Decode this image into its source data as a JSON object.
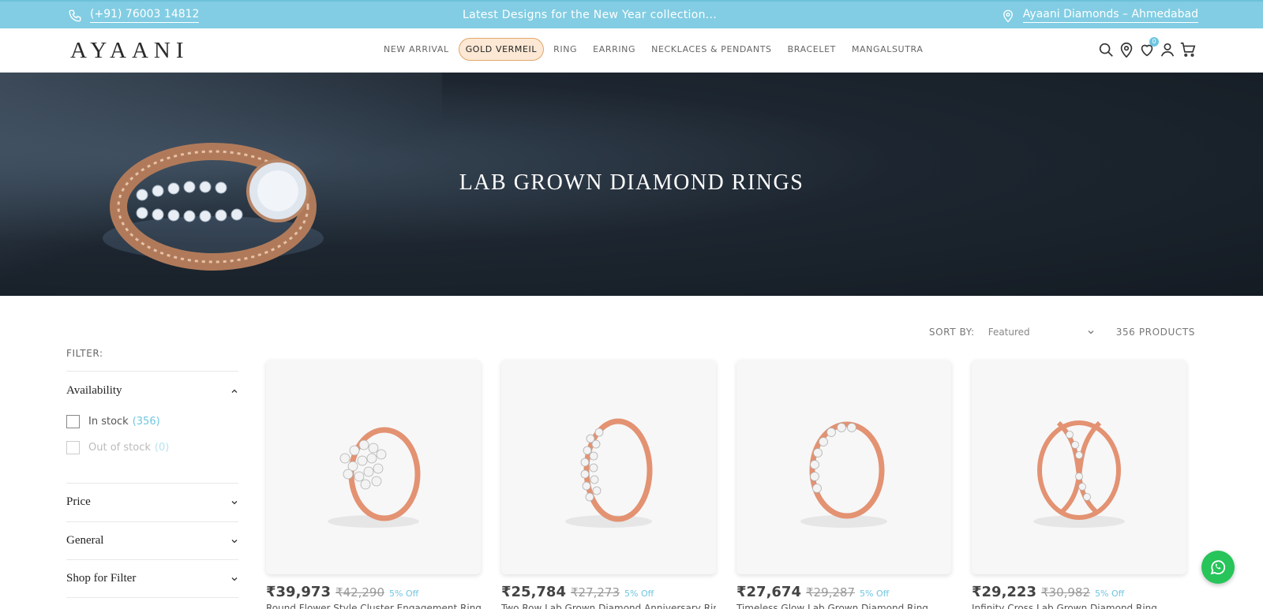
{
  "topbar": {
    "phone": "(+91) 76003 14812",
    "phone_icon": "phone-icon",
    "promo": "Latest Designs for the New Year collection...",
    "store": "Ayaani Diamonds – Ahmedabad",
    "store_icon": "location-pin-icon"
  },
  "header": {
    "logo": "AYAANI",
    "nav": [
      {
        "label": "NEW ARRIVAL"
      },
      {
        "label": "GOLD VERMEIL"
      },
      {
        "label": "RING"
      },
      {
        "label": "EARRING"
      },
      {
        "label": "NECKLACES & PENDANTS"
      },
      {
        "label": "BRACELET"
      },
      {
        "label": "MANGALSUTRA"
      }
    ],
    "wishlist_count": "0",
    "icons": [
      "search-icon",
      "store-locator-icon",
      "wishlist-heart-icon",
      "account-icon",
      "cart-icon"
    ]
  },
  "hero": {
    "title": "LAB GROWN DIAMOND RINGS"
  },
  "listing": {
    "sort_label": "SORT BY:",
    "sort_value": "Featured",
    "product_count": "356 PRODUCTS"
  },
  "filters": {
    "title": "FILTER:",
    "availability": {
      "label": "Availability",
      "options": [
        {
          "label": "In stock",
          "count": "(356)"
        },
        {
          "label": "Out of stock",
          "count": "(0)"
        }
      ]
    },
    "price": {
      "label": "Price"
    },
    "general": {
      "label": "General"
    },
    "shop_for": {
      "label": "Shop for Filter"
    }
  },
  "products": [
    {
      "price": "₹39,973",
      "mrp": "₹42,290",
      "off": "5% Off",
      "name": "Round Flower Style Cluster Engagement Ring"
    },
    {
      "price": "₹25,784",
      "mrp": "₹27,273",
      "off": "5% Off",
      "name": "Two Row Lab Grown Diamond Anniversary Ring"
    },
    {
      "price": "₹27,674",
      "mrp": "₹29,287",
      "off": "5% Off",
      "name": "Timeless Glow Lab Grown Diamond Ring"
    },
    {
      "price": "₹29,223",
      "mrp": "₹30,982",
      "off": "5% Off",
      "name": "Infinity Cross Lab Grown Diamond Ring"
    }
  ],
  "colors": {
    "topbar": "#82cde3",
    "accent": "#6fc6e0",
    "active_nav_bg": "#fce8d4",
    "active_nav_border": "#e3a66b",
    "whatsapp": "#27c45a"
  }
}
